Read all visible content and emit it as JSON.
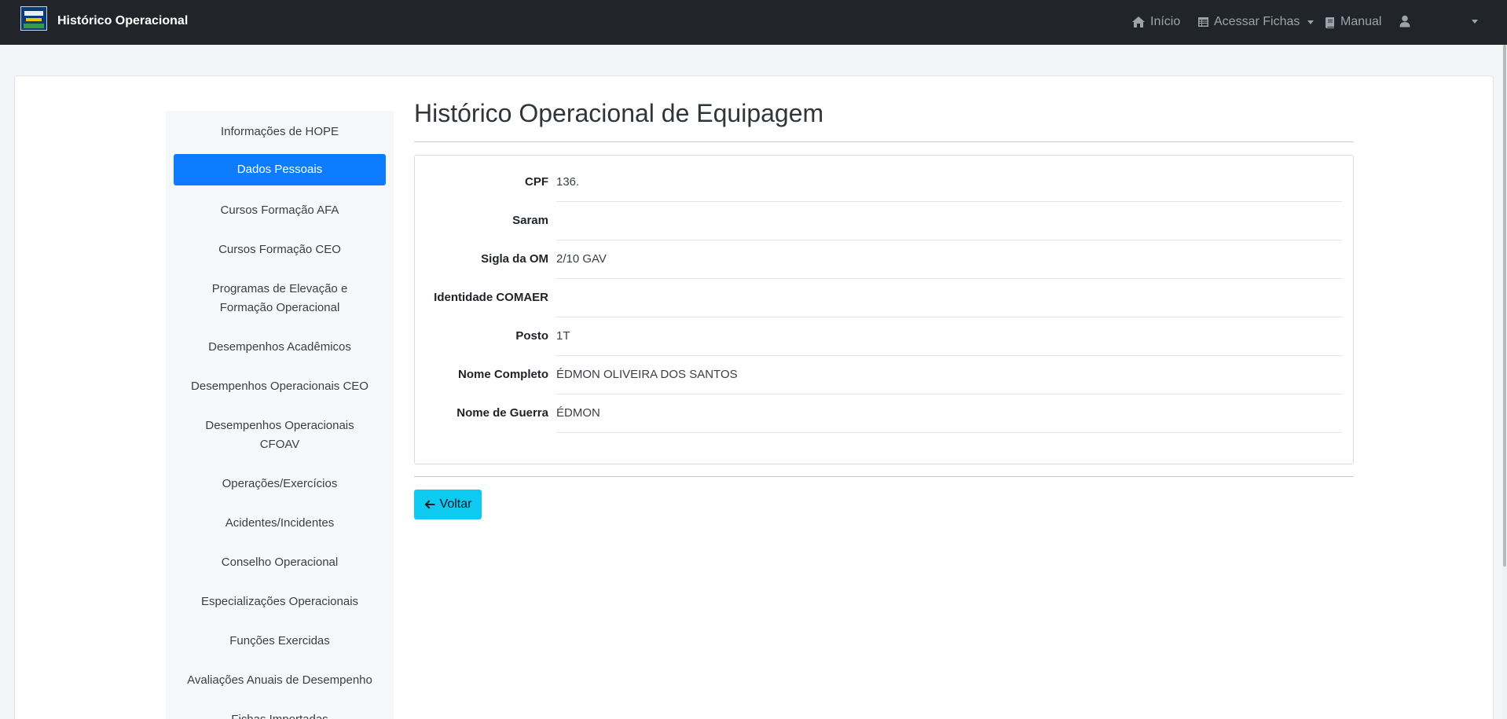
{
  "navbar": {
    "brand_title": "Histórico Operacional",
    "inicio_label": "Início",
    "acessar_fichas_label": "Acessar Fichas",
    "manual_label": "Manual"
  },
  "sidebar": {
    "items": [
      {
        "label": "Informações de HOPE"
      },
      {
        "label": "Dados Pessoais",
        "active": true
      },
      {
        "label": "Cursos Formação AFA"
      },
      {
        "label": "Cursos Formação CEO"
      },
      {
        "label": "Programas de Elevação e Formação Operacional"
      },
      {
        "label": "Desempenhos Acadêmicos"
      },
      {
        "label": "Desempenhos Operacionais CEO"
      },
      {
        "label": "Desempenhos Operacionais CFOAV"
      },
      {
        "label": "Operações/Exercícios"
      },
      {
        "label": "Acidentes/Incidentes"
      },
      {
        "label": "Conselho Operacional"
      },
      {
        "label": "Especializações Operacionais"
      },
      {
        "label": "Funções Exercidas"
      },
      {
        "label": "Avaliações Anuais de Desempenho"
      },
      {
        "label": "Fichas Importadas"
      }
    ]
  },
  "main": {
    "title": "Histórico Operacional de Equipagem",
    "fields": [
      {
        "label": "CPF",
        "value": "136."
      },
      {
        "label": "Saram",
        "value": ""
      },
      {
        "label": "Sigla da OM",
        "value": "2/10 GAV"
      },
      {
        "label": "Identidade COMAER",
        "value": ""
      },
      {
        "label": "Posto",
        "value": "1T"
      },
      {
        "label": "Nome Completo",
        "value": "ÉDMON OLIVEIRA DOS SANTOS"
      },
      {
        "label": "Nome de Guerra",
        "value": "ÉDMON"
      }
    ],
    "back_button_label": "Voltar"
  },
  "colors": {
    "navbar_bg": "#212529",
    "active_item": "#0d7cff",
    "back_button": "#0dcaf0"
  },
  "icons": {
    "home": "home-icon",
    "fichas": "table-icon",
    "manual": "book-icon",
    "user": "user-icon",
    "back": "arrow-left-icon"
  }
}
